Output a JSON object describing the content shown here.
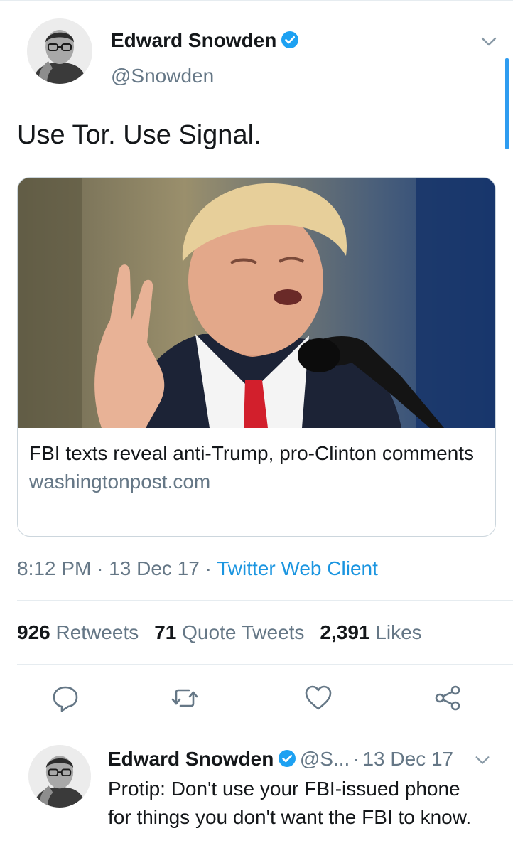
{
  "tweet": {
    "author_name": "Edward Snowden",
    "author_handle": "@Snowden",
    "text": "Use Tor. Use Signal.",
    "card": {
      "title": "FBI texts reveal anti-Trump, pro-Clinton comments",
      "domain": "washingtonpost.com"
    },
    "time": "8:12 PM",
    "date": "13 Dec 17",
    "separator": "·",
    "client": "Twitter Web Client",
    "stats": {
      "retweets_count": "926",
      "retweets_label": "Retweets",
      "quotes_count": "71",
      "quotes_label": "Quote Tweets",
      "likes_count": "2,391",
      "likes_label": "Likes"
    }
  },
  "reply": {
    "author_name": "Edward Snowden",
    "author_handle": "@S...",
    "separator": "·",
    "date": "13 Dec 17",
    "text": "Protip: Don't use your FBI-issued phone for things you don't want the FBI to know."
  },
  "icons": {
    "verified": "verified-badge-icon",
    "chevron": "chevron-down-icon",
    "reply": "reply-icon",
    "retweet": "retweet-icon",
    "like": "heart-icon",
    "share": "share-icon"
  },
  "colors": {
    "accent": "#1b95e0",
    "verified": "#1da1f2",
    "secondary_text": "#657786",
    "divider": "#e6ecf0",
    "tie_red": "#d21f2c",
    "suit_navy": "#1c2336"
  }
}
